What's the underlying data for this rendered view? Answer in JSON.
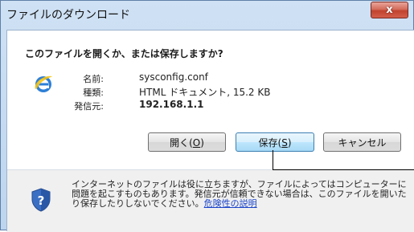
{
  "window": {
    "title": "ファイルのダウンロード",
    "close_label": "x"
  },
  "question": "このファイルを開くか、または保存しますか?",
  "file": {
    "name_label": "名前:",
    "name_value": "sysconfig.conf",
    "type_label": "種類:",
    "type_value": "HTML ドキュメント, 15.2 KB",
    "source_label": "発信元:",
    "source_value": "192.168.1.1",
    "icon": "ie-icon"
  },
  "buttons": {
    "open_prefix": "開く(",
    "open_key": "O",
    "open_suffix": ")",
    "save_prefix": "保存(",
    "save_key": "S",
    "save_suffix": ")",
    "cancel": "キャンセル"
  },
  "footer": {
    "shield_icon": "shield-question-icon",
    "warning_text": "インターネットのファイルは役に立ちますが、ファイルによってはコンピューターに問題を起こすものもあります。発信元が信頼できない場合は、このファイルを開いたり保存したりしないでください。",
    "risk_link": "危険性の説明"
  }
}
